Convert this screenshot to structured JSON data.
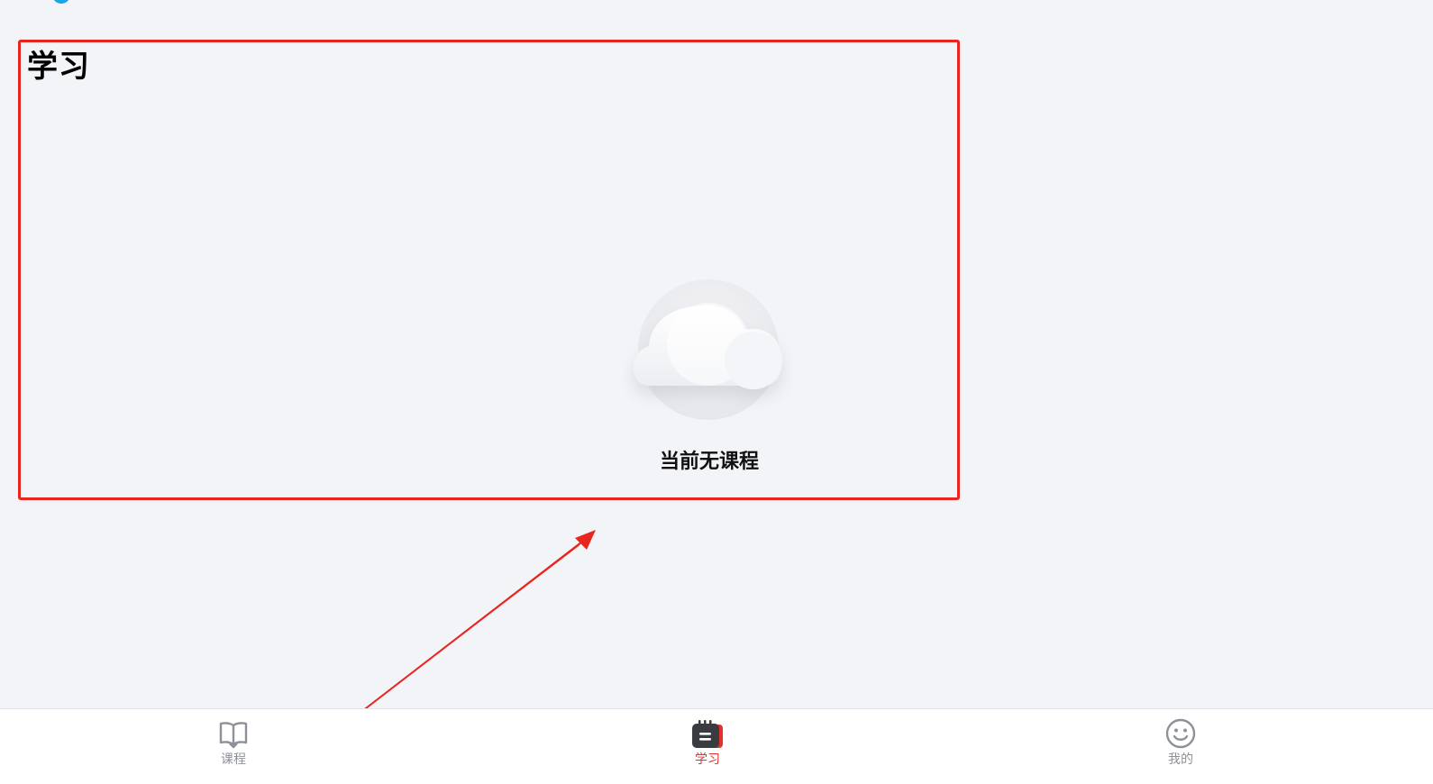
{
  "page": {
    "title": "学习"
  },
  "empty_state": {
    "icon": "cloud-icon",
    "message": "当前无课程"
  },
  "tabbar": {
    "active_index": 1,
    "active_color": "#e3312a",
    "inactive_color": "#8e9199",
    "items": [
      {
        "label": "课程",
        "icon": "open-book-icon"
      },
      {
        "label": "学习",
        "icon": "study-notebook-icon"
      },
      {
        "label": "我的",
        "icon": "smiley-face-icon"
      }
    ]
  },
  "annotation": {
    "highlight_color": "#e8261f"
  }
}
